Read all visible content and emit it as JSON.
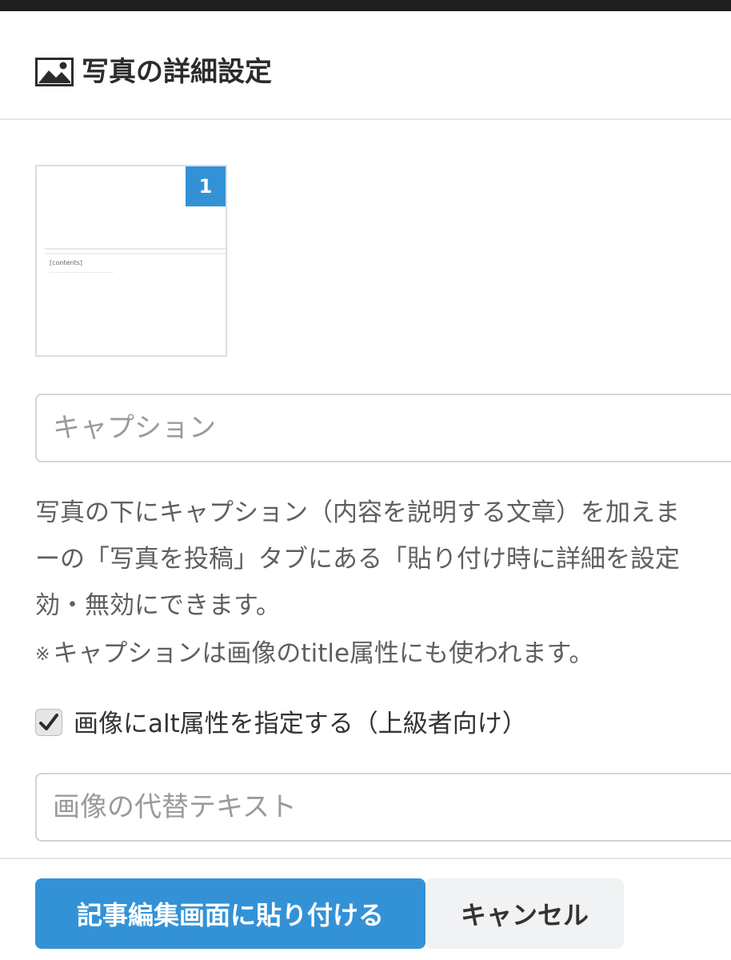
{
  "dialog": {
    "title": "写真の詳細設定",
    "title_icon": "image-icon"
  },
  "thumbnail": {
    "badge": "1",
    "preview_text": "[contents]"
  },
  "caption": {
    "placeholder": "キャプション",
    "value": ""
  },
  "description": {
    "lines": [
      "写真の下にキャプション（内容を説明する文章）を加えま",
      "ーの「写真を投稿」タブにある「貼り付け時に詳細を設定",
      "効・無効にできます。"
    ],
    "note_mark": "※",
    "note": "キャプションは画像のtitle属性にも使われます。"
  },
  "alt_option": {
    "label": "画像にalt属性を指定する（上級者向け）",
    "checked": true
  },
  "alt_text": {
    "placeholder": "画像の代替テキスト",
    "value": ""
  },
  "buttons": {
    "paste": "記事編集画面に貼り付ける",
    "cancel": "キャンセル"
  },
  "colors": {
    "accent": "#3392d6",
    "cancel_bg": "#f1f2f3"
  }
}
